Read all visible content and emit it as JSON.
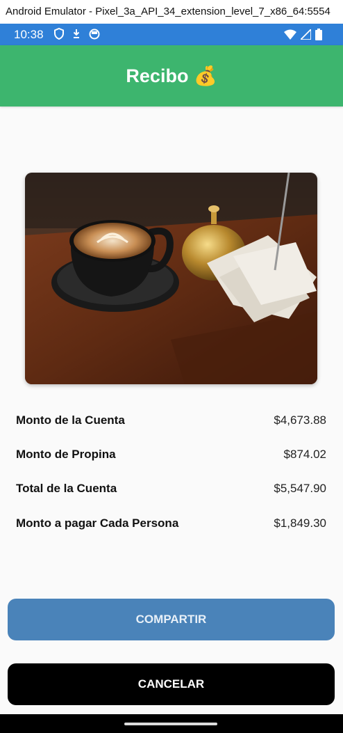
{
  "window": {
    "title": "Android Emulator - Pixel_3a_API_34_extension_level_7_x86_64:5554"
  },
  "status_bar": {
    "time": "10:38",
    "left_icons": [
      "shield-icon",
      "download-icon",
      "circle-app-icon"
    ],
    "right_icons": [
      "wifi-icon",
      "signal-icon",
      "battery-icon"
    ]
  },
  "app_bar": {
    "title": "Recibo 💰"
  },
  "image": {
    "description_icon": "coffee-receipt-photo"
  },
  "summary": [
    {
      "label": "Monto de la Cuenta",
      "value": "$4,673.88"
    },
    {
      "label": "Monto de Propina",
      "value": "$874.02"
    },
    {
      "label": "Total de la Cuenta",
      "value": "$5,547.90"
    },
    {
      "label": "Monto a pagar Cada Persona",
      "value": "$1,849.30"
    }
  ],
  "buttons": {
    "share": "COMPARTIR",
    "cancel": "CANCELAR"
  },
  "colors": {
    "status_bar": "#2f80d8",
    "app_bar": "#3db56e",
    "share_button": "#4a83b9",
    "cancel_button": "#000000"
  }
}
